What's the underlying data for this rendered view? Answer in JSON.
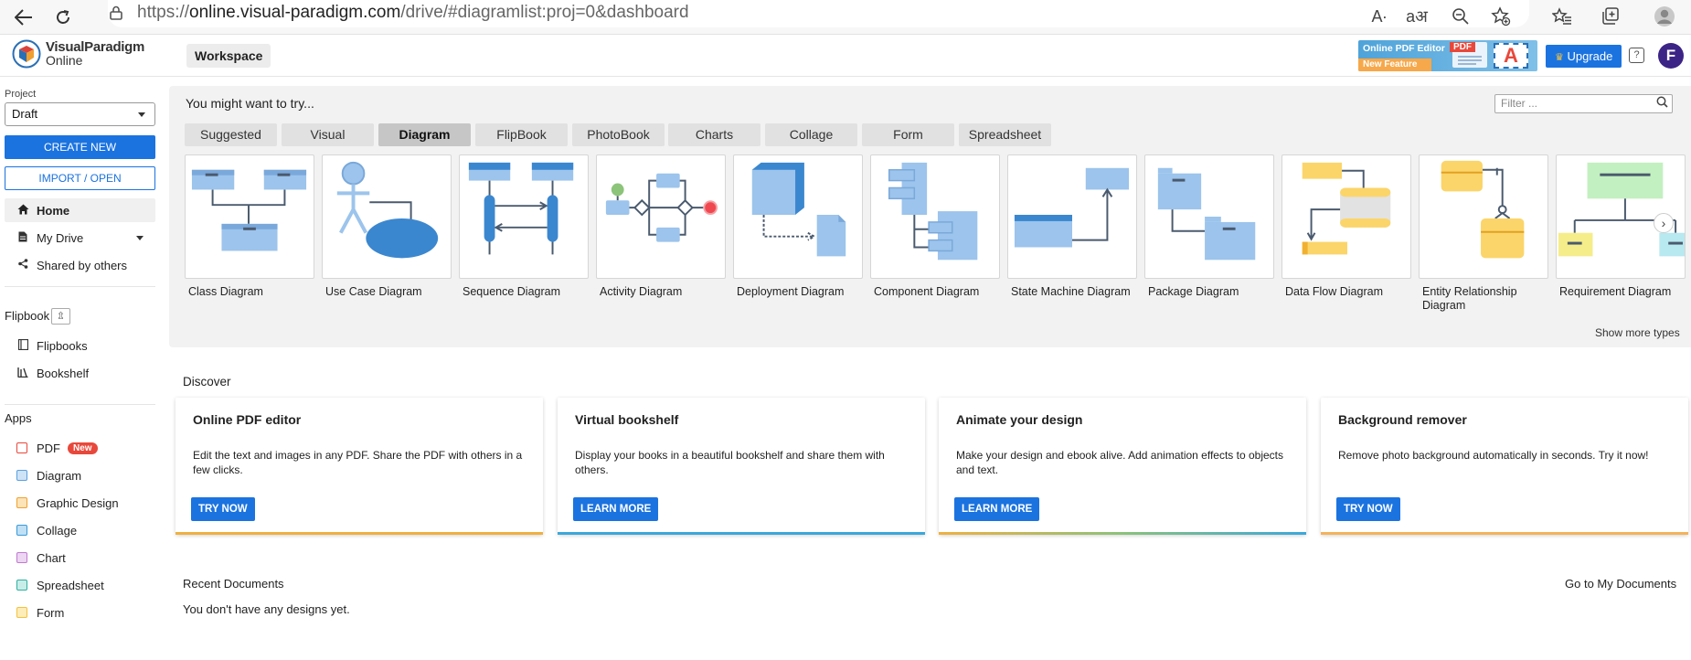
{
  "browser": {
    "url_prefix": "https://",
    "url_host": "online.visual-paradigm.com",
    "url_path": "/drive/#diagramlist:proj=0&dashboard",
    "read_aloud_icon": "A∙",
    "translate_icon": "aअ"
  },
  "header": {
    "logo_line1": "VisualParadigm",
    "logo_line2": "Online",
    "workspace": "Workspace",
    "banner_title": "Online PDF Editor",
    "banner_feature": "New Feature",
    "banner_pdf": "PDF",
    "banner_a": "A",
    "upgrade": "Upgrade",
    "help": "?",
    "avatar_initial": "F",
    "accent_color": "#1b73e0",
    "avatar_color": "#3c2486"
  },
  "sidebar": {
    "project_label": "Project",
    "project_value": "Draft",
    "create_new": "CREATE NEW",
    "import_open": "IMPORT / OPEN",
    "nav": [
      {
        "label": "Home",
        "icon": "home-icon"
      },
      {
        "label": "My Drive",
        "icon": "file-icon"
      },
      {
        "label": "Shared by others",
        "icon": "share-icon"
      }
    ],
    "flipbook_heading": "Flipbook",
    "flipbook_items": [
      {
        "label": "Flipbooks",
        "icon": "book-icon"
      },
      {
        "label": "Bookshelf",
        "icon": "bookshelf-icon"
      }
    ],
    "apps_heading": "Apps",
    "apps": [
      {
        "label": "PDF",
        "badge": "New",
        "color": "#e8483b"
      },
      {
        "label": "Diagram",
        "color": "#5aa0e0"
      },
      {
        "label": "Graphic Design",
        "color": "#f0a030"
      },
      {
        "label": "Collage",
        "color": "#3a9ad9"
      },
      {
        "label": "Chart",
        "color": "#c07ad0"
      },
      {
        "label": "Spreadsheet",
        "color": "#2fb0a0"
      },
      {
        "label": "Form",
        "color": "#f5c040"
      }
    ]
  },
  "try_panel": {
    "title": "You might want to try...",
    "filter_placeholder": "Filter ...",
    "tabs": [
      "Suggested",
      "Visual",
      "Diagram",
      "FlipBook",
      "PhotoBook",
      "Charts",
      "Collage",
      "Form",
      "Spreadsheet"
    ],
    "active_tab": "Diagram",
    "cards": [
      "Class Diagram",
      "Use Case Diagram",
      "Sequence Diagram",
      "Activity Diagram",
      "Deployment Diagram",
      "Component Diagram",
      "State Machine Diagram",
      "Package Diagram",
      "Data Flow Diagram",
      "Entity Relationship Diagram",
      "Requirement Diagram"
    ],
    "show_more": "Show more types"
  },
  "discover": {
    "title": "Discover",
    "cards": [
      {
        "title": "Online PDF editor",
        "desc": "Edit the text and images in any PDF. Share the PDF with others in a few clicks.",
        "button": "TRY NOW",
        "bar": "#f0b040"
      },
      {
        "title": "Virtual bookshelf",
        "desc": "Display your books in a beautiful bookshelf and share them with others.",
        "button": "LEARN MORE",
        "bar": "#3aa8dc"
      },
      {
        "title": "Animate your design",
        "desc": "Make your design and ebook alive. Add animation effects to objects and text.",
        "button": "LEARN MORE",
        "bar": "#8bc27a"
      },
      {
        "title": "Background remover",
        "desc": "Remove photo background automatically in seconds. Try it now!",
        "button": "TRY NOW",
        "bar": "#f5b25a"
      }
    ]
  },
  "recent": {
    "title": "Recent Documents",
    "goto": "Go to My Documents",
    "empty": "You don't have any designs yet."
  }
}
